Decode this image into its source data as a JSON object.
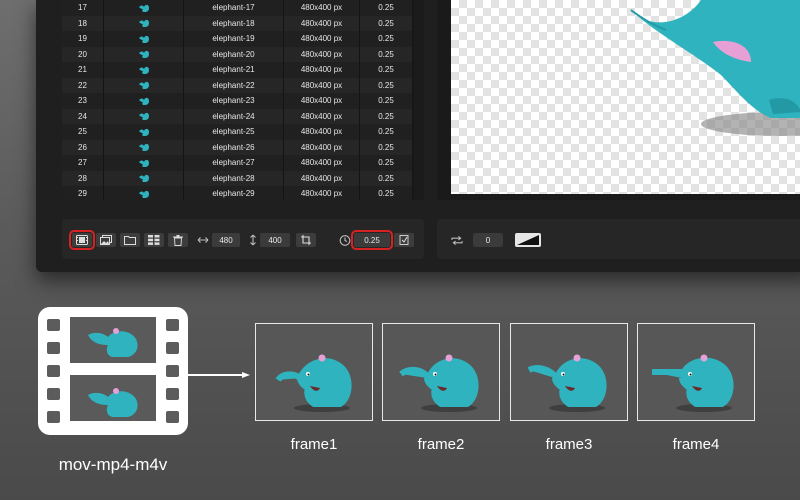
{
  "frames_table": {
    "rows": [
      {
        "index": "17",
        "name": "elephant-17",
        "size": "480x400 px",
        "duration": "0.25"
      },
      {
        "index": "18",
        "name": "elephant-18",
        "size": "480x400 px",
        "duration": "0.25"
      },
      {
        "index": "19",
        "name": "elephant-19",
        "size": "480x400 px",
        "duration": "0.25"
      },
      {
        "index": "20",
        "name": "elephant-20",
        "size": "480x400 px",
        "duration": "0.25"
      },
      {
        "index": "21",
        "name": "elephant-21",
        "size": "480x400 px",
        "duration": "0.25"
      },
      {
        "index": "22",
        "name": "elephant-22",
        "size": "480x400 px",
        "duration": "0.25"
      },
      {
        "index": "23",
        "name": "elephant-23",
        "size": "480x400 px",
        "duration": "0.25"
      },
      {
        "index": "24",
        "name": "elephant-24",
        "size": "480x400 px",
        "duration": "0.25"
      },
      {
        "index": "25",
        "name": "elephant-25",
        "size": "480x400 px",
        "duration": "0.25"
      },
      {
        "index": "26",
        "name": "elephant-26",
        "size": "480x400 px",
        "duration": "0.25"
      },
      {
        "index": "27",
        "name": "elephant-27",
        "size": "480x400 px",
        "duration": "0.25"
      },
      {
        "index": "28",
        "name": "elephant-28",
        "size": "480x400 px",
        "duration": "0.25"
      },
      {
        "index": "29",
        "name": "elephant-29",
        "size": "480x400 px",
        "duration": "0.25"
      }
    ]
  },
  "toolbar": {
    "width_value": "480",
    "height_value": "400",
    "duration_value": "0.25",
    "loop_count": "0",
    "icons": {
      "import_video": "film-icon",
      "import_image": "images-icon",
      "open_folder": "folder-icon",
      "grid": "grid-icon",
      "delete": "trash-icon",
      "width": "horizontal-resize-icon",
      "height": "vertical-resize-icon",
      "crop": "crop-icon",
      "timer": "timer-icon",
      "apply_duration": "apply-icon",
      "loop": "loop-icon",
      "background": "background-swatch-icon"
    }
  },
  "illustration": {
    "format_label": "mov-mp4-m4v",
    "frames": [
      "frame1",
      "frame2",
      "frame3",
      "frame4"
    ]
  },
  "colors": {
    "highlight": "#d62222",
    "elephant": "#2fb3bf",
    "ear": "#e7a0d6"
  }
}
